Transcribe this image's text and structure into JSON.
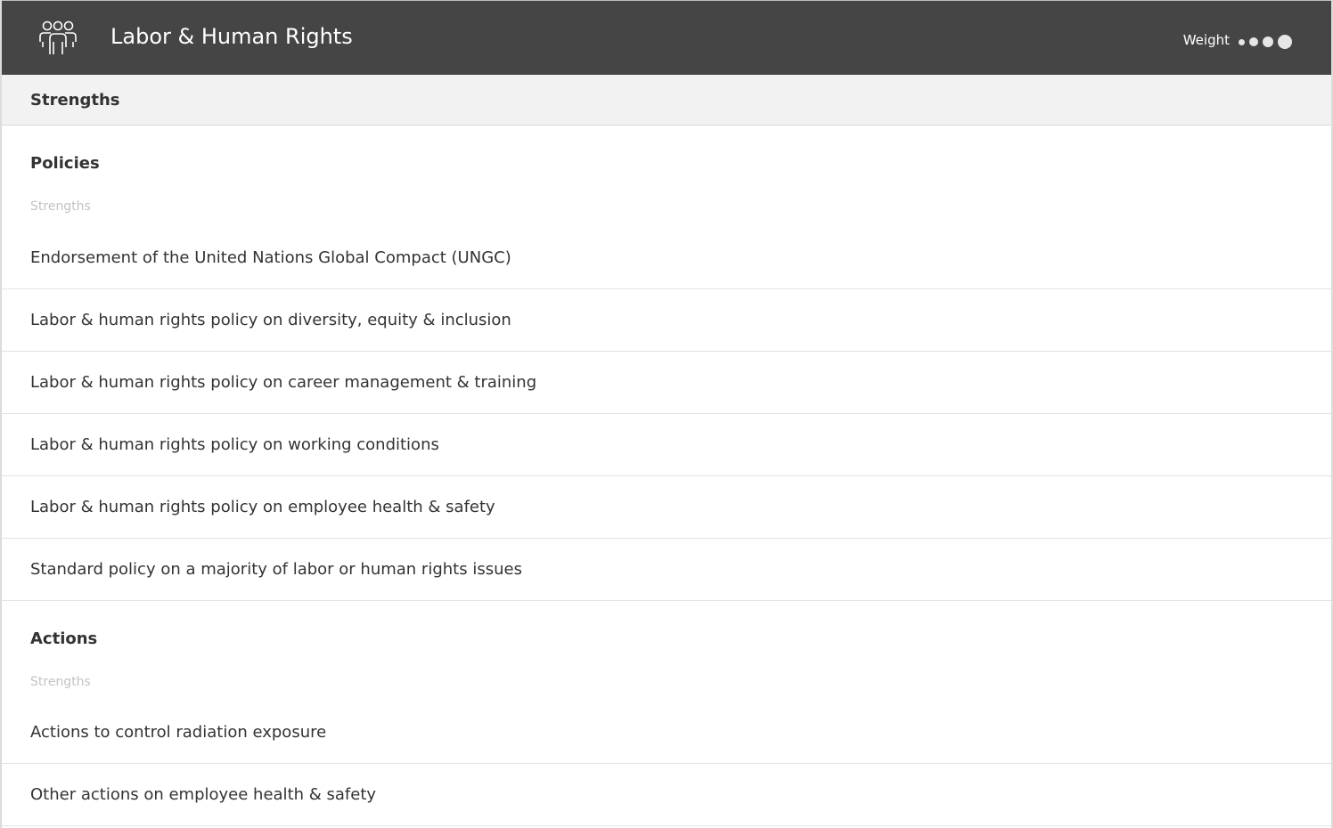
{
  "header": {
    "title": "Labor & Human Rights",
    "icon": "people-group-icon",
    "weight_label": "Weight",
    "weight_level": 4,
    "weight_max": 4,
    "background_color": "#454545"
  },
  "section": {
    "title": "Strengths"
  },
  "groups": [
    {
      "title": "Policies",
      "subtitle": "Strengths",
      "items": [
        "Endorsement of the United Nations Global Compact (UNGC)",
        "Labor & human rights policy on diversity, equity & inclusion",
        "Labor & human rights policy on career management & training",
        "Labor & human rights policy on working conditions",
        "Labor & human rights policy on employee health & safety",
        "Standard policy on a majority of labor or human rights issues"
      ]
    },
    {
      "title": "Actions",
      "subtitle": "Strengths",
      "items": [
        "Actions to control radiation exposure",
        "Other actions on employee health & safety"
      ]
    }
  ]
}
